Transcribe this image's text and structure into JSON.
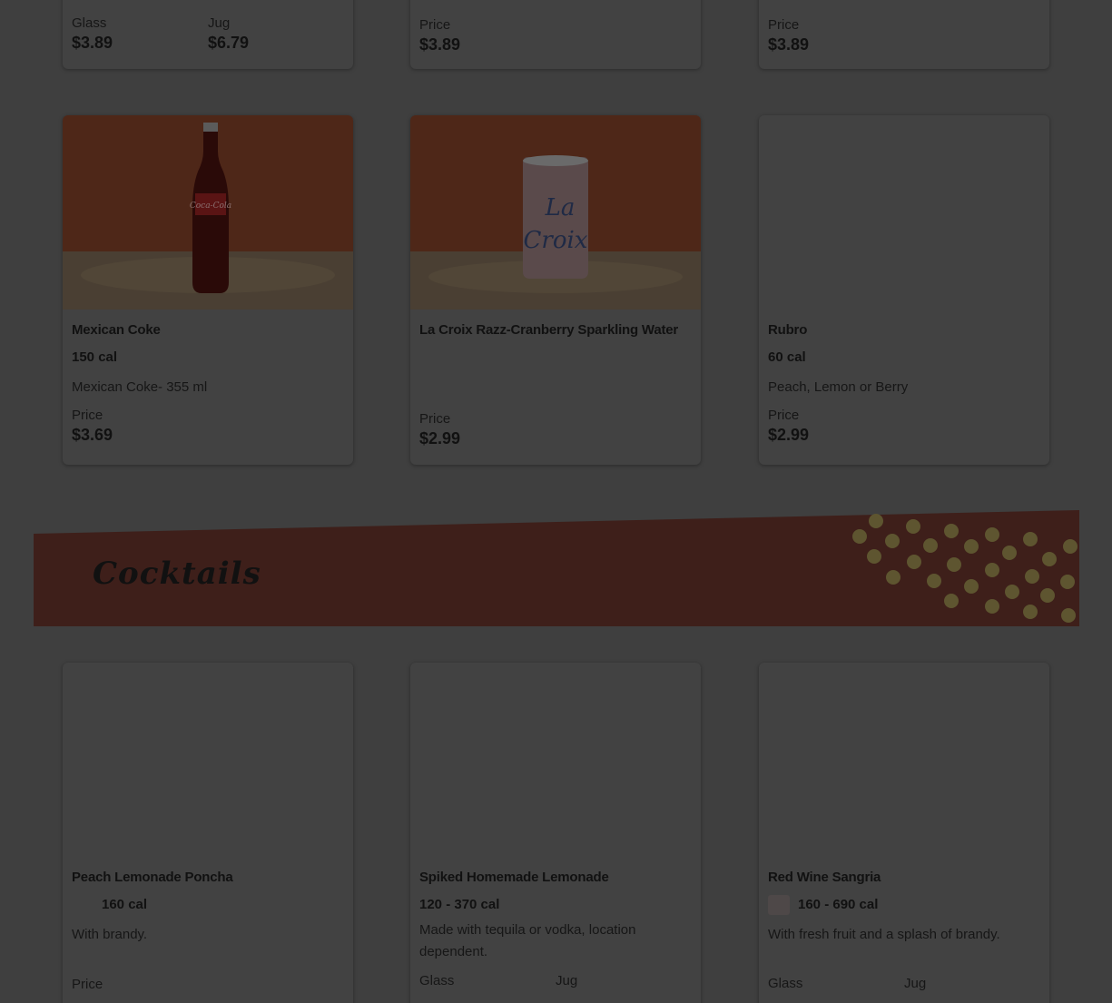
{
  "top_row": [
    {
      "pair": [
        {
          "label": "Glass",
          "value": "$3.89"
        },
        {
          "label": "Jug",
          "value": "$6.79"
        }
      ]
    },
    {
      "price_label": "Price",
      "price": "$3.89"
    },
    {
      "price_label": "Price",
      "price": "$3.89"
    }
  ],
  "row2": [
    {
      "name": "Mexican Coke",
      "cal": "150 cal",
      "desc": "Mexican Coke- 355 ml",
      "price_label": "Price",
      "price": "$3.69",
      "image": "coke-bottle-image"
    },
    {
      "name": "La Croix Razz-Cranberry Sparkling Water",
      "price_label": "Price",
      "price": "$2.99",
      "image": "lacroix-can-image"
    },
    {
      "name": "Rubro",
      "cal": "60 cal",
      "desc": "Peach, Lemon or Berry",
      "price_label": "Price",
      "price": "$2.99"
    }
  ],
  "section": {
    "title": "Cocktails",
    "accent_color": "#3e1f1a",
    "dot_color": "#5e5530"
  },
  "row3": [
    {
      "name": "Peach Lemonade Poncha",
      "cal": "160 cal",
      "desc": "With brandy.",
      "price_label": "Price"
    },
    {
      "name": "Spiked Homemade Lemonade",
      "cal": "120 - 370 cal",
      "desc": "Made with tequila or vodka, location dependent.",
      "glass_label": "Glass",
      "jug_label": "Jug"
    },
    {
      "name": "Red Wine Sangria",
      "cal": "160 - 690 cal",
      "desc": "With fresh fruit and a splash of brandy.",
      "glass_label": "Glass",
      "jug_label": "Jug"
    }
  ]
}
